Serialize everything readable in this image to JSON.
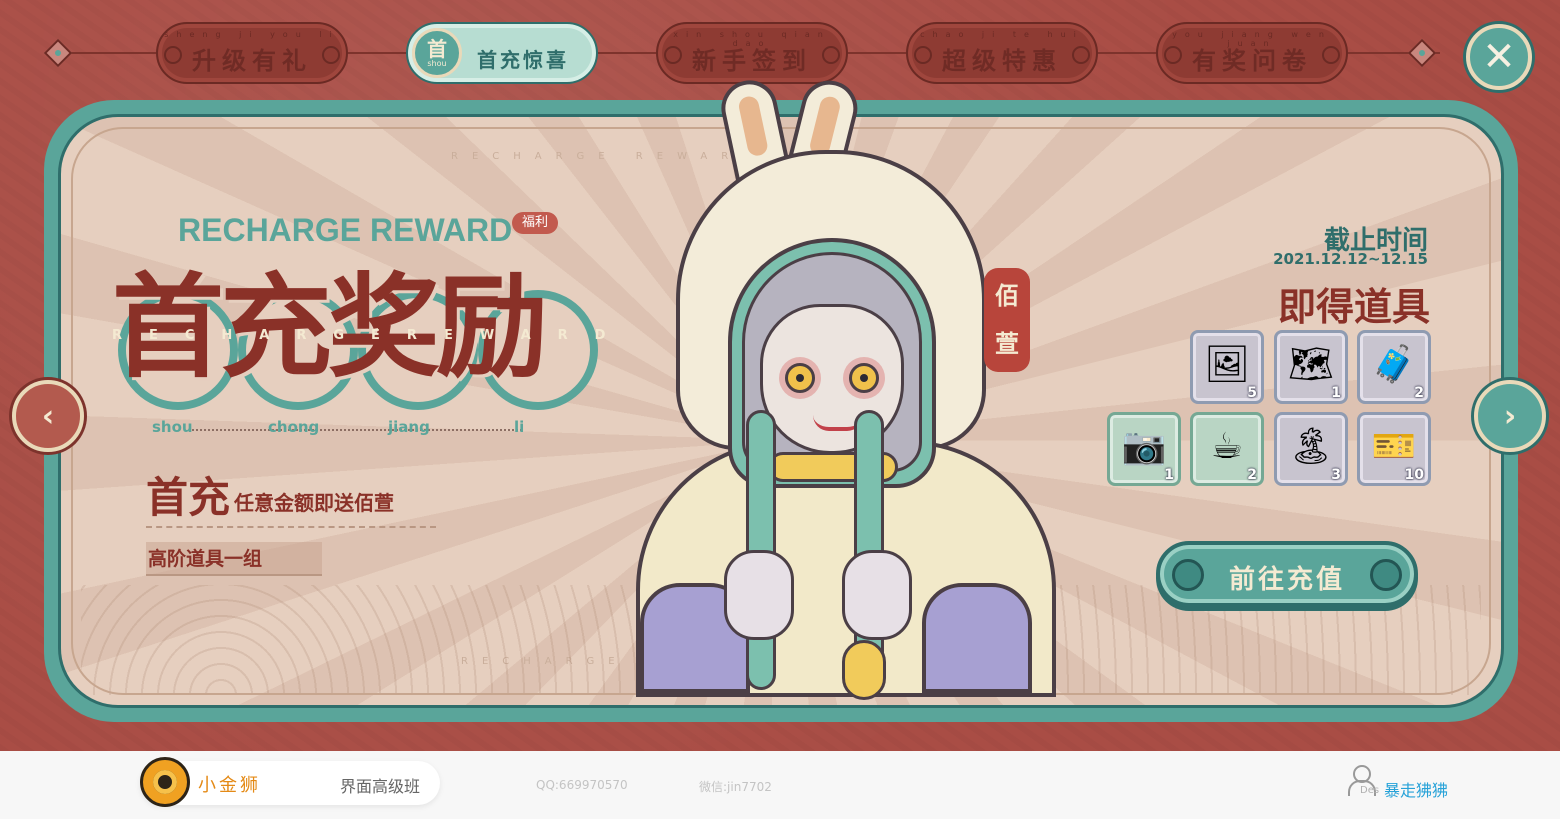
{
  "tabs": [
    {
      "label": "升级有礼",
      "pinyin": "sheng ji you li",
      "active": false
    },
    {
      "label": "首充惊喜",
      "pinyin": "",
      "active": true,
      "badge_char": "首",
      "badge_pinyin": "shou"
    },
    {
      "label": "新手签到",
      "pinyin": "xin shou qian dao",
      "active": false
    },
    {
      "label": "超级特惠",
      "pinyin": "chao ji te hui",
      "active": false
    },
    {
      "label": "有奖问卷",
      "pinyin": "you jiang wen juan",
      "active": false
    }
  ],
  "close_icon": "✕",
  "watermark_text": "RECHARGE  REWARD",
  "title": {
    "english": "RECHARGE REWARD",
    "badge": "福利",
    "chinese": "首充奖励",
    "overlay": "RECHARGEREWARD",
    "pinyin": [
      "shou",
      "chong",
      "jiang",
      "li"
    ]
  },
  "promo": {
    "big": "首充",
    "small": "任意金额即送佰萱",
    "sub": "高阶道具一组"
  },
  "seal_text": [
    "佰",
    "萱"
  ],
  "deadline": {
    "label": "截止时间",
    "date": "2021.12.12~12.15"
  },
  "items_title": "即得道具",
  "items": [
    {
      "icon": "photos-icon",
      "glyph": "🖼",
      "count": "5",
      "style": "grey"
    },
    {
      "icon": "map-icon",
      "glyph": "🗺",
      "count": "1",
      "style": "grey"
    },
    {
      "icon": "suitcase-icon",
      "glyph": "🧳",
      "count": "2",
      "style": "grey"
    },
    {
      "icon": "camera-icon",
      "glyph": "📷",
      "count": "1",
      "style": "green"
    },
    {
      "icon": "coffee-icon",
      "glyph": "☕",
      "count": "2",
      "style": "green"
    },
    {
      "icon": "postcard-icon",
      "glyph": "🏝",
      "count": "3",
      "style": "grey"
    },
    {
      "icon": "ticket-icon",
      "glyph": "🎫",
      "count": "10",
      "style": "grey"
    }
  ],
  "recharge_button": "前往充值",
  "arrows": {
    "left": "‹",
    "right": "›"
  },
  "footer": {
    "brand": "小金狮",
    "course": "界面高级班",
    "qq": "QQ:669970570",
    "wechat": "微信:jin7702",
    "des": "Des",
    "author": "暴走狒狒"
  },
  "colors": {
    "background_red": "#a94d45",
    "teal": "#5aa59a",
    "dark_teal": "#2f6e6b",
    "paper": "#e6cfbf",
    "title_red": "#8a3128",
    "brand_orange": "#e48a16",
    "author_blue": "#27a2d8"
  }
}
